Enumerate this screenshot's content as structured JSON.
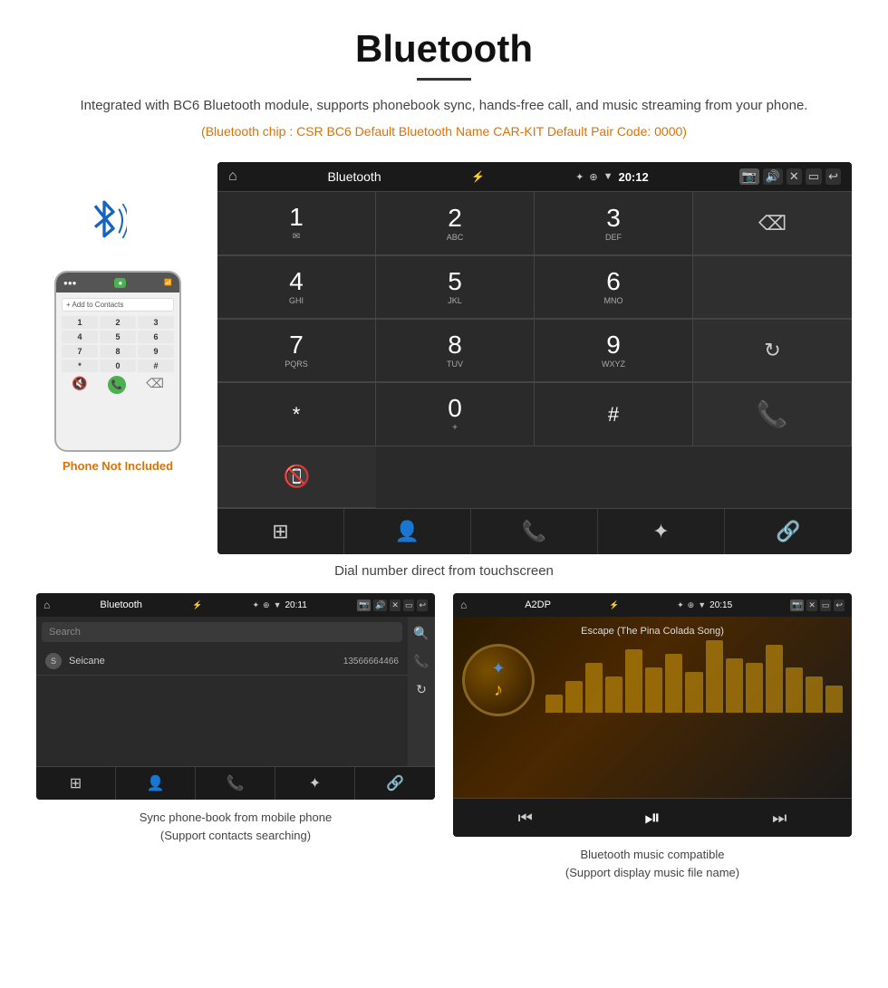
{
  "page": {
    "title": "Bluetooth",
    "subtitle": "Integrated with BC6 Bluetooth module, supports phonebook sync, hands-free call, and music streaming from your phone.",
    "specs": "(Bluetooth chip : CSR BC6    Default Bluetooth Name CAR-KIT    Default Pair Code: 0000)",
    "dial_caption": "Dial number direct from touchscreen"
  },
  "head_unit": {
    "status_bar": {
      "title": "Bluetooth",
      "time": "20:12"
    },
    "dialpad": {
      "keys": [
        {
          "num": "1",
          "letters": ""
        },
        {
          "num": "2",
          "letters": "ABC"
        },
        {
          "num": "3",
          "letters": "DEF"
        },
        {
          "num": "backspace",
          "letters": ""
        },
        {
          "num": "4",
          "letters": "GHI"
        },
        {
          "num": "5",
          "letters": "JKL"
        },
        {
          "num": "6",
          "letters": "MNO"
        },
        {
          "num": "",
          "letters": ""
        },
        {
          "num": "7",
          "letters": "PQRS"
        },
        {
          "num": "8",
          "letters": "TUV"
        },
        {
          "num": "9",
          "letters": "WXYZ"
        },
        {
          "num": "refresh",
          "letters": ""
        },
        {
          "num": "*",
          "letters": ""
        },
        {
          "num": "0+",
          "letters": ""
        },
        {
          "num": "#",
          "letters": ""
        },
        {
          "num": "call_green",
          "letters": ""
        },
        {
          "num": "call_red",
          "letters": ""
        }
      ]
    },
    "bottom_nav": [
      "dialpad",
      "contact",
      "phone",
      "bluetooth",
      "link"
    ]
  },
  "phonebook_screen": {
    "status_bar": {
      "title": "Bluetooth",
      "time": "20:11"
    },
    "search_placeholder": "Search",
    "contact": {
      "letter": "S",
      "name": "Seicane",
      "phone": "13566664466"
    }
  },
  "music_screen": {
    "status_bar": {
      "title": "A2DP",
      "time": "20:15"
    },
    "song_title": "Escape (The Pina Colada Song)",
    "eq_bars": [
      20,
      35,
      55,
      40,
      70,
      50,
      65,
      45,
      80,
      60,
      55,
      75,
      50,
      40,
      30
    ]
  },
  "captions": {
    "phonebook": "Sync phone-book from mobile phone\n(Support contacts searching)",
    "music": "Bluetooth music compatible\n(Support display music file name)"
  },
  "phone_not_included": "Phone Not Included"
}
